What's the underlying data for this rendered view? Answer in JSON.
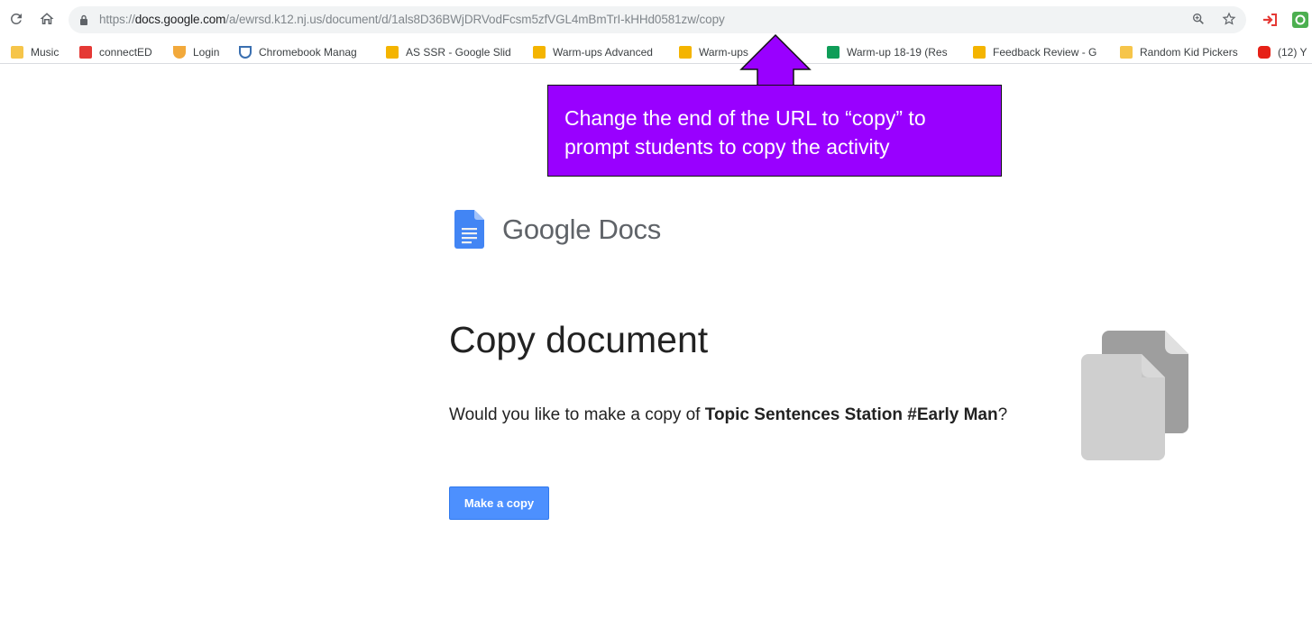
{
  "browser": {
    "url_prefix": "https://",
    "url_host": "docs.google.com",
    "url_path": "/a/ewrsd.k12.nj.us/document/d/1als8D36BWjDRVodFcsm5zfVGL4mBmTrI-kHHd0581zw/copy",
    "icons": [
      "reload-icon",
      "home-icon",
      "lock-icon",
      "zoom-icon",
      "star-icon"
    ]
  },
  "bookmarks": [
    {
      "label": "Music",
      "color": "#f6c54a"
    },
    {
      "label": "connectED",
      "color": "#e53935"
    },
    {
      "label": "Login",
      "color": "#f2a93b"
    },
    {
      "label": "Chromebook Manag",
      "color": "#3a6fb0"
    },
    {
      "label": "AS SSR - Google Slid",
      "color": "#f4b400"
    },
    {
      "label": "Warm-ups Advanced",
      "color": "#f4b400"
    },
    {
      "label": "Warm-ups",
      "color": "#f4b400"
    },
    {
      "label": "Warm-up 18-19 (Res",
      "color": "#0f9d58"
    },
    {
      "label": "Feedback Review - G",
      "color": "#f4b400"
    },
    {
      "label": "Random Kid Pickers",
      "color": "#f6c54a"
    },
    {
      "label": "(12) Y",
      "color": "#e62117"
    }
  ],
  "callout": {
    "text": "Change the end of the URL to “copy” to prompt students to copy the activity",
    "background": "#9900ff"
  },
  "page": {
    "brand_google": "Google",
    "brand_product": "Docs",
    "title": "Copy document",
    "prompt_before": "Would you like to make a copy of ",
    "document_name": "Topic Sentences Station #Early Man",
    "prompt_after": "?",
    "button_label": "Make a copy",
    "button_color": "#4d90fe"
  }
}
